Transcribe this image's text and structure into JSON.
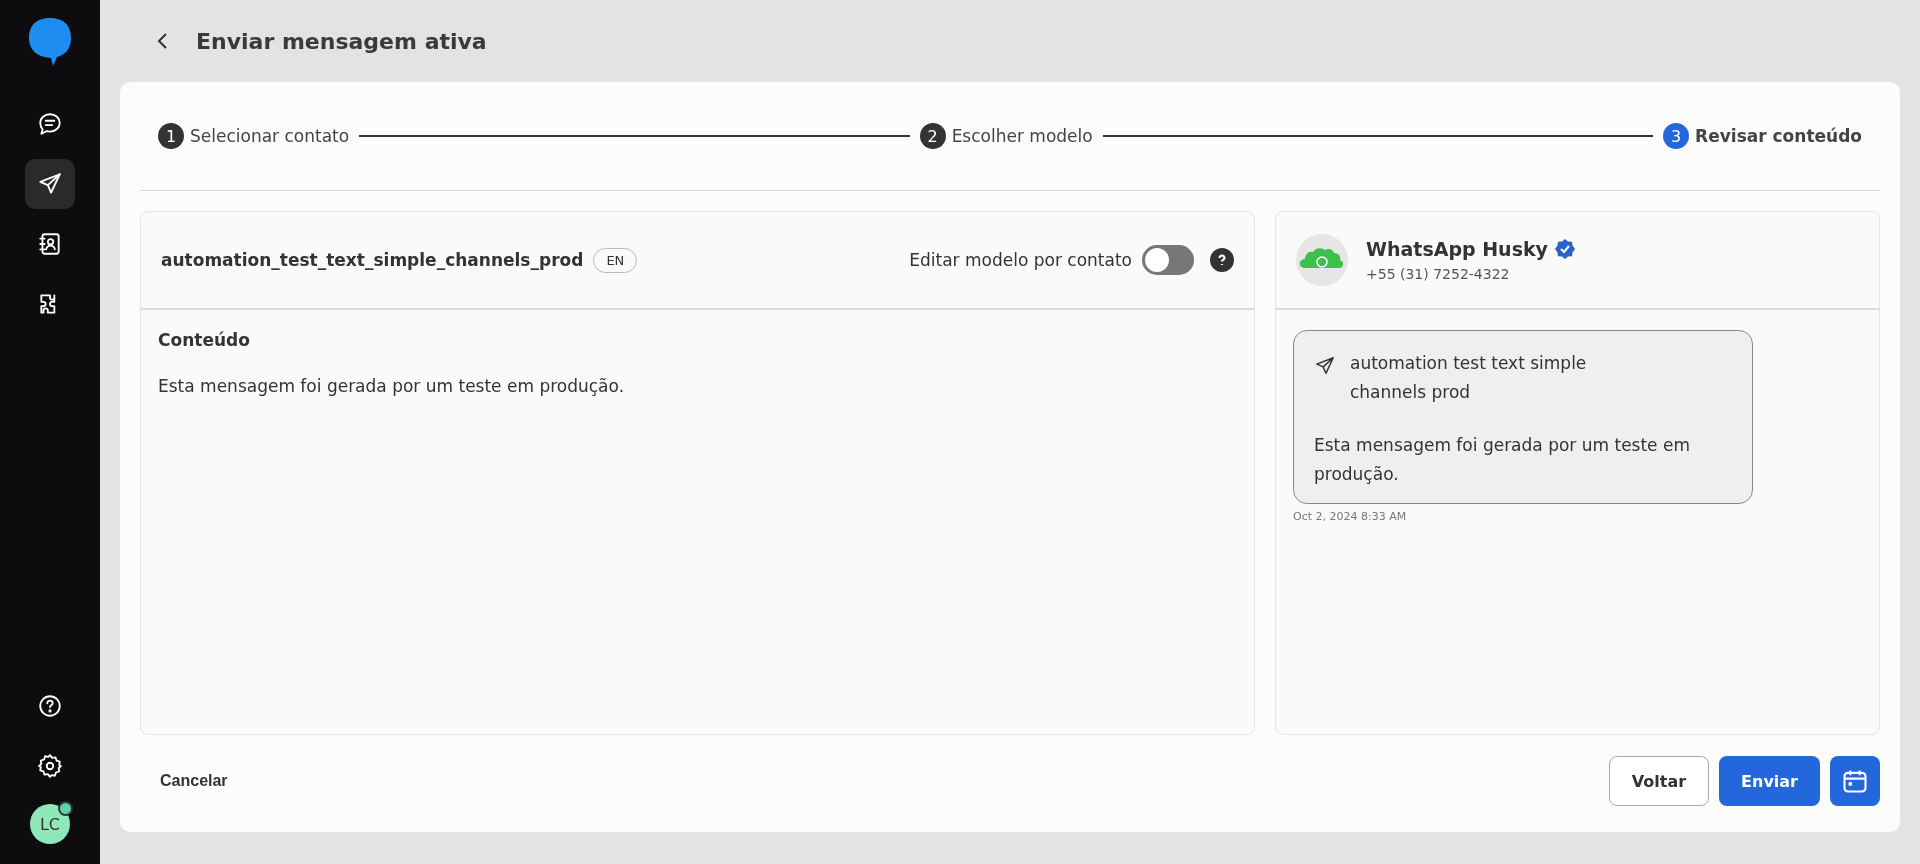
{
  "sidebar": {
    "nav_items": [
      {
        "kind": "chat",
        "selected": false
      },
      {
        "kind": "send",
        "selected": true
      },
      {
        "kind": "contacts",
        "selected": false
      },
      {
        "kind": "integrations",
        "selected": false
      }
    ],
    "bottom_items": [
      {
        "kind": "help"
      },
      {
        "kind": "settings"
      }
    ],
    "avatar": {
      "initials": "LC",
      "online": true
    }
  },
  "header": {
    "title": "Enviar mensagem ativa"
  },
  "steps": [
    {
      "number": "1",
      "label": "Selecionar contato",
      "selected": false
    },
    {
      "number": "2",
      "label": "Escolher modelo",
      "selected": false
    },
    {
      "number": "3",
      "label": "Revisar conteúdo",
      "selected": true
    }
  ],
  "template_panel": {
    "name": "automation_test_text_simple_channels_prod",
    "language": "EN",
    "toggle_label": "Editar modelo por contato",
    "toggle_on": false,
    "content_heading": "Conteúdo",
    "content": "Esta mensagem foi gerada por um teste em produção."
  },
  "preview_panel": {
    "channel_name": "WhatsApp Husky",
    "verified": true,
    "phone": "+55 (31) 7252-4322",
    "message_title": "automation test text simple channels prod",
    "message_body": "Esta mensagem foi gerada por um teste em produção.",
    "timestamp": "Oct 2, 2024 8:33 AM"
  },
  "footer": {
    "cancel": "Cancelar",
    "back": "Voltar",
    "send": "Enviar"
  }
}
